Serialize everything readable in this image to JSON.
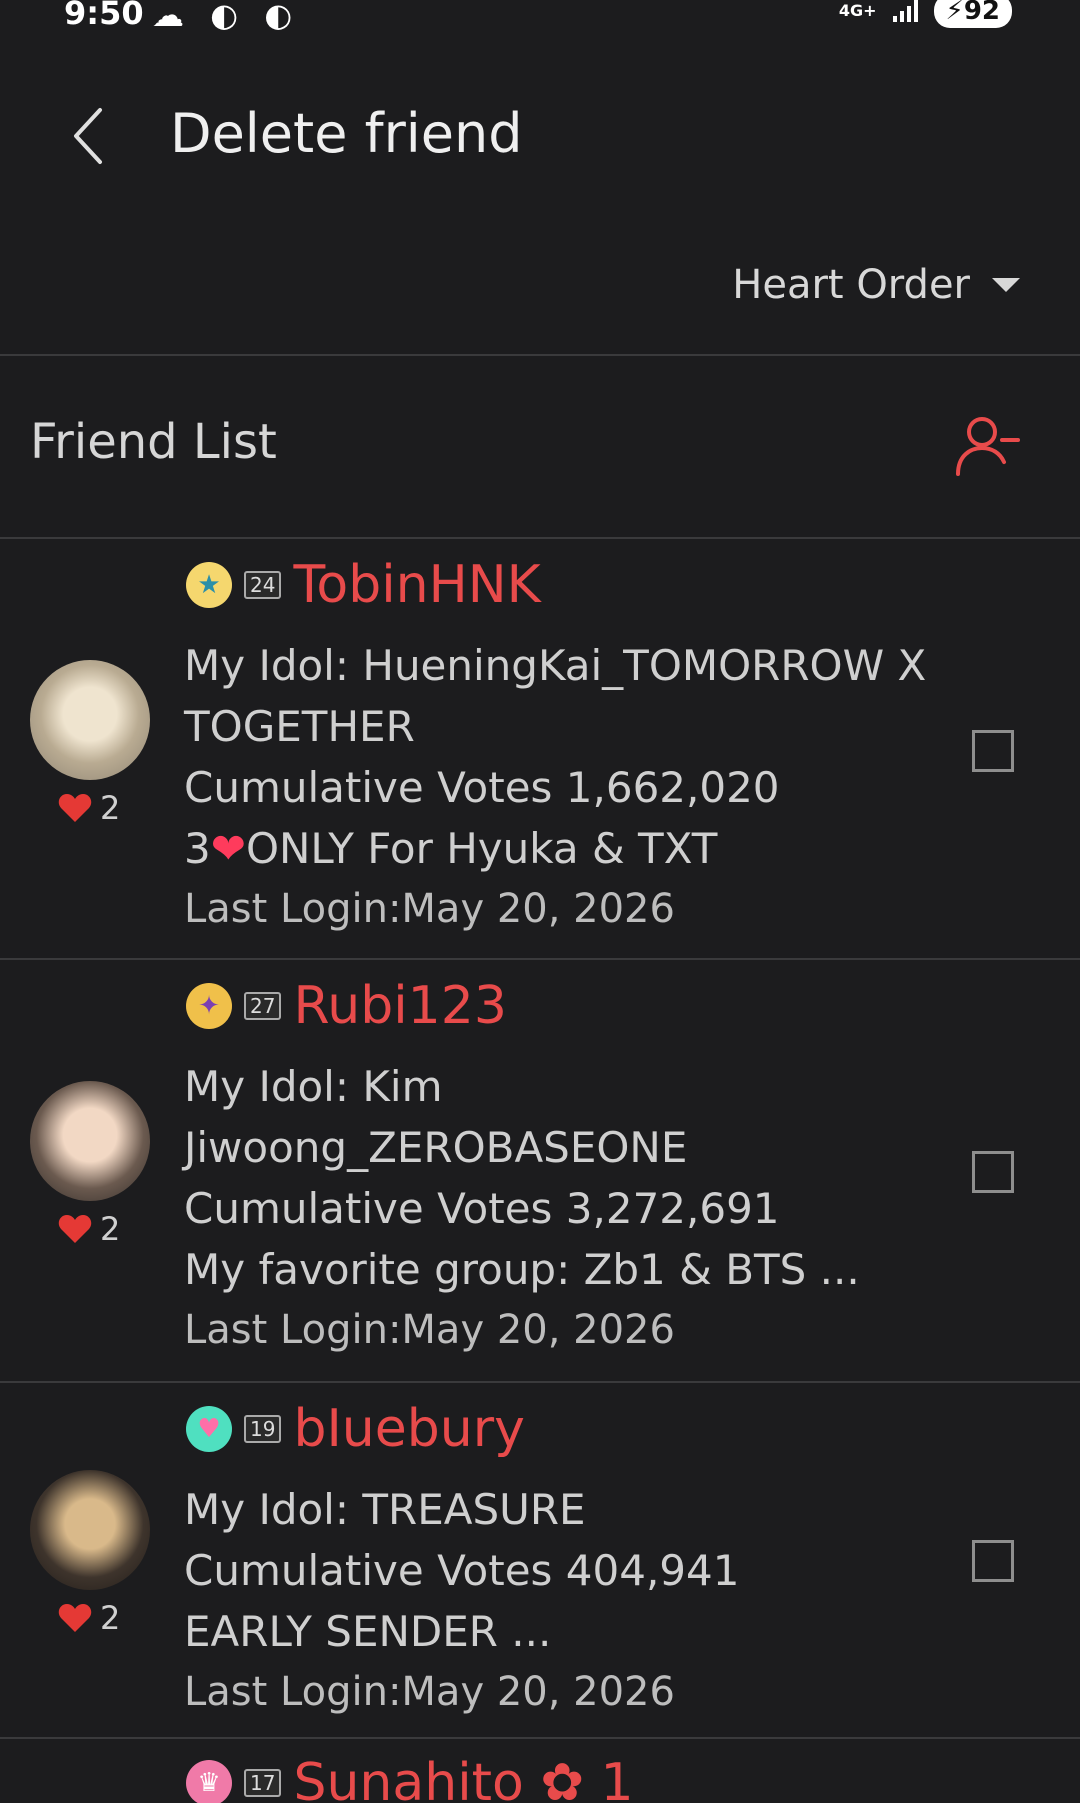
{
  "status": {
    "time": "9:50",
    "network": "4G+",
    "battery": "92"
  },
  "header": {
    "title": "Delete friend"
  },
  "sort": {
    "label": "Heart Order"
  },
  "section": {
    "title": "Friend List"
  },
  "colors": {
    "background": "#1c1c1e",
    "accent": "#e84b4b",
    "divider": "#3a3a3c"
  },
  "friends": [
    {
      "level": "24",
      "name": "TobinHNK",
      "hearts": "2",
      "idol_line1": "My Idol: HueningKai_TOMORROW X",
      "idol_line2": "TOGETHER",
      "votes": "Cumulative Votes 1,662,020",
      "status_pre": "3",
      "status_post": "ONLY For Hyuka & TXT",
      "last_login": "Last Login:May 20, 2026"
    },
    {
      "level": "27",
      "name": "Rubi123",
      "hearts": "2",
      "idol_line1": "My Idol: Kim",
      "idol_line2": "Jiwoong_ZEROBASEONE",
      "votes": "Cumulative Votes 3,272,691",
      "status": "My favorite group: Zb1 & BTS ...",
      "last_login": "Last Login:May 20, 2026"
    },
    {
      "level": "19",
      "name": "bIuebury",
      "hearts": "2",
      "idol_line1": "My Idol: TREASURE",
      "votes": "Cumulative Votes 404,941",
      "status": "EARLY SENDER ...",
      "last_login": "Last Login:May 20, 2026"
    },
    {
      "level": "17",
      "name": "Sunahito ✿ 1"
    }
  ]
}
